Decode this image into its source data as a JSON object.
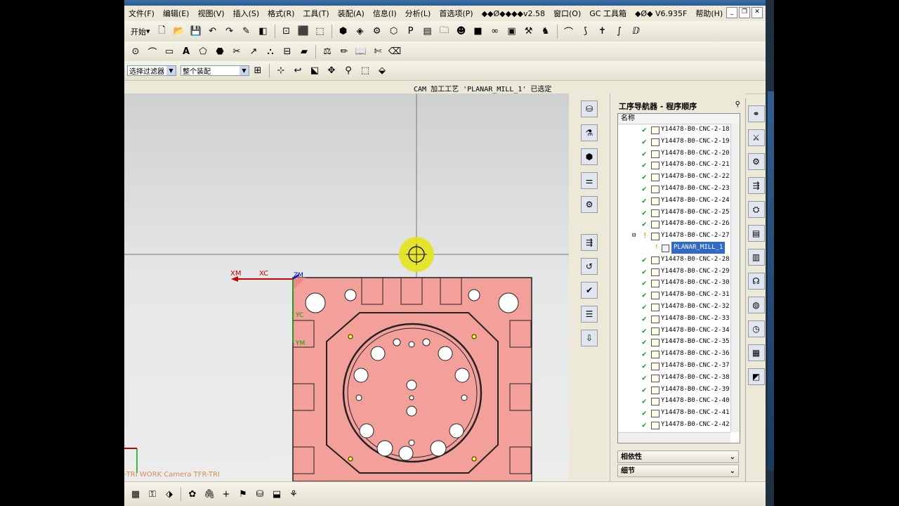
{
  "menu": [
    "文件(F)",
    "编辑(E)",
    "视图(V)",
    "插入(S)",
    "格式(R)",
    "工具(T)",
    "装配(A)",
    "信息(I)",
    "分析(L)",
    "首选项(P)",
    "◆◆Ø◆◆◆◆v2.58",
    "窗口(O)",
    "GC 工具箱",
    "◆Ø◆ V6.935F",
    "帮助(H)"
  ],
  "toolbar": {
    "start_label": "开始",
    "filter_select": "选择过滤器",
    "assembly_select": "整个装配"
  },
  "status_message": "CAM 加工工艺 'PLANAR_MILL_1' 已选定",
  "navigator": {
    "title": "工序导航器 - 程序顺序",
    "column_name": "名称",
    "items_before": [
      "Y14478-B0-CNC-2-18",
      "Y14478-B0-CNC-2-19",
      "Y14478-B0-CNC-2-20",
      "Y14478-B0-CNC-2-21",
      "Y14478-B0-CNC-2-22",
      "Y14478-B0-CNC-2-23",
      "Y14478-B0-CNC-2-24",
      "Y14478-B0-CNC-2-25",
      "Y14478-B0-CNC-2-26"
    ],
    "expanded_item": "Y14478-B0-CNC-2-27",
    "selected_child": "PLANAR_MILL_1",
    "items_after": [
      "Y14478-B0-CNC-2-28",
      "Y14478-B0-CNC-2-29",
      "Y14478-B0-CNC-2-30",
      "Y14478-B0-CNC-2-31",
      "Y14478-B0-CNC-2-32",
      "Y14478-B0-CNC-2-33",
      "Y14478-B0-CNC-2-34",
      "Y14478-B0-CNC-2-35",
      "Y14478-B0-CNC-2-36",
      "Y14478-B0-CNC-2-37",
      "Y14478-B0-CNC-2-38",
      "Y14478-B0-CNC-2-39",
      "Y14478-B0-CNC-2-40",
      "Y14478-B0-CNC-2-41",
      "Y14478-B0-CNC-2-42"
    ],
    "panel_dependencies": "相依性",
    "panel_details": "细节"
  },
  "viewport": {
    "axis_xm": "XM",
    "axis_xc": "XC",
    "axis_zm": "ZM",
    "axis_yc": "YC",
    "axis_ym": "YM",
    "camera_label": "-TRI WORK Camera TFR-TRI"
  },
  "colors": {
    "part_fill": "#f4a09a",
    "accent_selected": "#316ac5",
    "check": "#1a9a1a"
  }
}
